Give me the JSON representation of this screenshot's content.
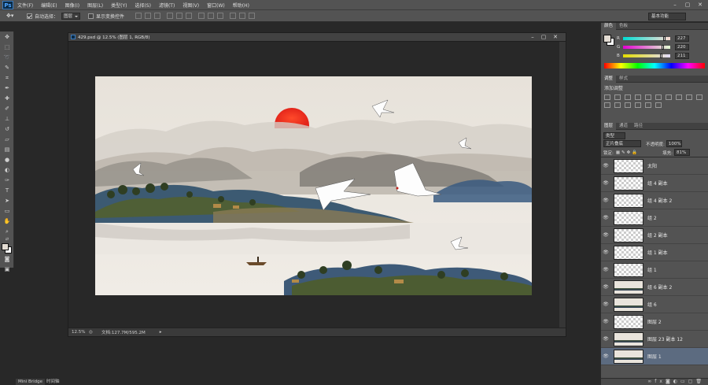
{
  "menubar": {
    "logo": "Ps",
    "items": [
      "文件(F)",
      "编辑(E)",
      "图像(I)",
      "图层(L)",
      "类型(Y)",
      "选择(S)",
      "滤镜(T)",
      "视图(V)",
      "窗口(W)",
      "帮助(H)"
    ]
  },
  "options": {
    "auto_select_label": "自动选择：",
    "auto_select_value": "图层",
    "show_transform_label": "显示变换控件",
    "workspace": "基本功能"
  },
  "document": {
    "title": "429.psd @ 12.5% (图层 1, RGB/8)",
    "zoom": "12.5%",
    "doc_size": "文档:127.7M/595.2M"
  },
  "color_panel": {
    "tabs": [
      "颜色",
      "色板"
    ],
    "channels": [
      {
        "label": "R",
        "value": "227",
        "level": 0.89
      },
      {
        "label": "G",
        "value": "220",
        "level": 0.86
      },
      {
        "label": "B",
        "value": "211",
        "level": 0.83
      }
    ]
  },
  "adjust_panel": {
    "tabs": [
      "调整",
      "样式"
    ],
    "title": "添加调整"
  },
  "layers_panel": {
    "tabs": [
      "图层",
      "通道",
      "路径"
    ],
    "filter_kind": "类型",
    "blend_mode": "正片叠底",
    "opacity_label": "不透明度:",
    "opacity_value": "100%",
    "lock_label": "锁定:",
    "fill_label": "填充:",
    "fill_value": "81%",
    "layers": [
      {
        "name": "太阳",
        "thumb": "empty",
        "selected": false
      },
      {
        "name": "组 4 副本",
        "thumb": "empty",
        "selected": false
      },
      {
        "name": "组 4 副本 2",
        "thumb": "empty",
        "selected": false
      },
      {
        "name": "组 2",
        "thumb": "empty",
        "selected": false
      },
      {
        "name": "组 2 副本",
        "thumb": "empty",
        "selected": false
      },
      {
        "name": "组 1 副本",
        "thumb": "empty",
        "selected": false
      },
      {
        "name": "组 1",
        "thumb": "empty",
        "selected": false
      },
      {
        "name": "组 6 副本 2",
        "thumb": "land",
        "selected": false
      },
      {
        "name": "组 6",
        "thumb": "land",
        "selected": false
      },
      {
        "name": "图层 2",
        "thumb": "empty",
        "selected": false
      },
      {
        "name": "图层 23 副本 12",
        "thumb": "land",
        "selected": false
      },
      {
        "name": "图层 1",
        "thumb": "land",
        "selected": true
      }
    ]
  },
  "bottom_tabs": [
    "Mini Bridge",
    "时间轴"
  ]
}
